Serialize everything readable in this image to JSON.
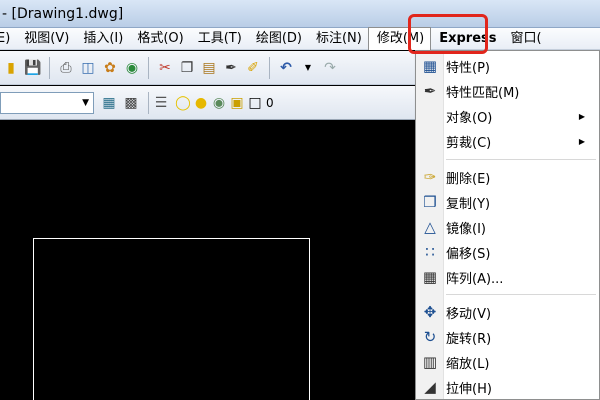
{
  "window": {
    "title": "- [Drawing1.dwg]"
  },
  "menubar": {
    "items": [
      {
        "label": "E)"
      },
      {
        "label": "视图(V)"
      },
      {
        "label": "插入(I)"
      },
      {
        "label": "格式(O)"
      },
      {
        "label": "工具(T)"
      },
      {
        "label": "绘图(D)"
      },
      {
        "label": "标注(N)"
      },
      {
        "label": "修改(M)"
      },
      {
        "label": "Express"
      },
      {
        "label": "窗口("
      }
    ]
  },
  "layer_toolbar": {
    "layer_value": "0"
  },
  "modify_menu": {
    "items": [
      {
        "label": "特性(P)",
        "icon": "properties-icon"
      },
      {
        "label": "特性匹配(M)",
        "icon": "match-properties-icon"
      },
      {
        "label": "对象(O)",
        "icon": "",
        "submenu": true
      },
      {
        "label": "剪裁(C)",
        "icon": "",
        "submenu": true
      },
      {
        "label": "删除(E)",
        "icon": "erase-icon"
      },
      {
        "label": "复制(Y)",
        "icon": "copy-icon"
      },
      {
        "label": "镜像(I)",
        "icon": "mirror-icon"
      },
      {
        "label": "偏移(S)",
        "icon": "offset-icon"
      },
      {
        "label": "阵列(A)...",
        "icon": "array-icon"
      },
      {
        "label": "移动(V)",
        "icon": "move-icon"
      },
      {
        "label": "旋转(R)",
        "icon": "rotate-icon"
      },
      {
        "label": "缩放(L)",
        "icon": "scale-icon"
      },
      {
        "label": "拉伸(H)",
        "icon": "stretch-icon"
      }
    ]
  },
  "colors": {
    "highlight": "#e1261c",
    "canvas": "#000000",
    "shape": "#ffffff"
  }
}
